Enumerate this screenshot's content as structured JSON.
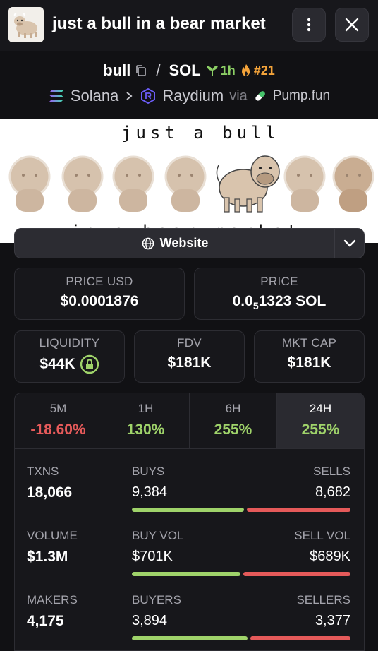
{
  "header": {
    "title": "just a bull in a bear market",
    "menu_icon": "more-vertical-icon",
    "close_icon": "close-icon"
  },
  "pair": {
    "base": "bull",
    "separator": "/",
    "quote": "SOL",
    "age": "1h",
    "rank": "#21",
    "chain": "Solana",
    "dex": "Raydium",
    "via": "via",
    "launchpad": "Pump.fun"
  },
  "banner": {
    "line1": "just a bull",
    "line2": "in a bear market"
  },
  "website": {
    "label": "Website"
  },
  "stats": {
    "price_usd": {
      "label": "PRICE USD",
      "value": "$0.0001876"
    },
    "price": {
      "label": "PRICE",
      "prefix": "0.0",
      "zeros": "5",
      "suffix": "1323 SOL"
    },
    "liquidity": {
      "label": "LIQUIDITY",
      "value": "$44K"
    },
    "fdv": {
      "label": "FDV",
      "value": "$181K"
    },
    "mkt_cap": {
      "label": "MKT CAP",
      "value": "$181K"
    }
  },
  "timeframes": [
    {
      "label": "5M",
      "value": "-18.60%",
      "trend": "negative"
    },
    {
      "label": "1H",
      "value": "130%",
      "trend": "positive"
    },
    {
      "label": "6H",
      "value": "255%",
      "trend": "positive"
    },
    {
      "label": "24H",
      "value": "255%",
      "trend": "positive",
      "active": true
    }
  ],
  "metrics": {
    "txns": {
      "label": "TXNS",
      "value": "18,066"
    },
    "volume": {
      "label": "VOLUME",
      "value": "$1.3M"
    },
    "makers": {
      "label": "MAKERS",
      "value": "4,175"
    }
  },
  "splits": {
    "txns": {
      "left_label": "BUYS",
      "right_label": "SELLS",
      "left_value": "9,384",
      "right_value": "8,682",
      "left_share": 0.519
    },
    "volume": {
      "left_label": "BUY VOL",
      "right_label": "SELL VOL",
      "left_value": "$701K",
      "right_value": "$689K",
      "left_share": 0.504
    },
    "makers": {
      "left_label": "BUYERS",
      "right_label": "SELLERS",
      "left_value": "3,894",
      "right_value": "3,377",
      "left_share": 0.536
    }
  },
  "colors": {
    "positive": "#9fd36a",
    "negative": "#e55a5a",
    "age": "#8ccf65",
    "rank": "#f3a33a",
    "background": "#111114"
  }
}
